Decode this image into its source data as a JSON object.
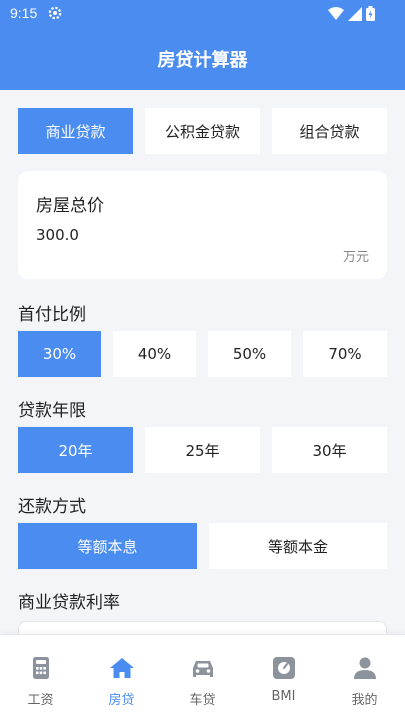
{
  "status": {
    "time": "9:15"
  },
  "header": {
    "title": "房贷计算器"
  },
  "loan_types": [
    "商业贷款",
    "公积金贷款",
    "组合贷款"
  ],
  "loan_type_selected": "商业贷款",
  "price_card": {
    "title": "房屋总价",
    "value": "300.0",
    "unit": "万元"
  },
  "down_payment": {
    "title": "首付比例",
    "options": [
      "30%",
      "40%",
      "50%",
      "70%"
    ],
    "selected": "30%"
  },
  "term": {
    "title": "贷款年限",
    "options": [
      "20年",
      "25年",
      "30年"
    ],
    "selected": "20年"
  },
  "repayment": {
    "title": "还款方式",
    "options": [
      "等额本息",
      "等额本金"
    ],
    "selected": "等额本息"
  },
  "rate": {
    "title": "商业贷款利率"
  },
  "nav": {
    "items": [
      {
        "label": "工资",
        "icon": "calculator-icon"
      },
      {
        "label": "房贷",
        "icon": "house-icon"
      },
      {
        "label": "车贷",
        "icon": "car-icon"
      },
      {
        "label": "BMI",
        "icon": "scale-icon"
      },
      {
        "label": "我的",
        "icon": "person-icon"
      }
    ],
    "active": "房贷"
  },
  "colors": {
    "primary": "#4A8CF0",
    "background": "#F3F5F9"
  }
}
